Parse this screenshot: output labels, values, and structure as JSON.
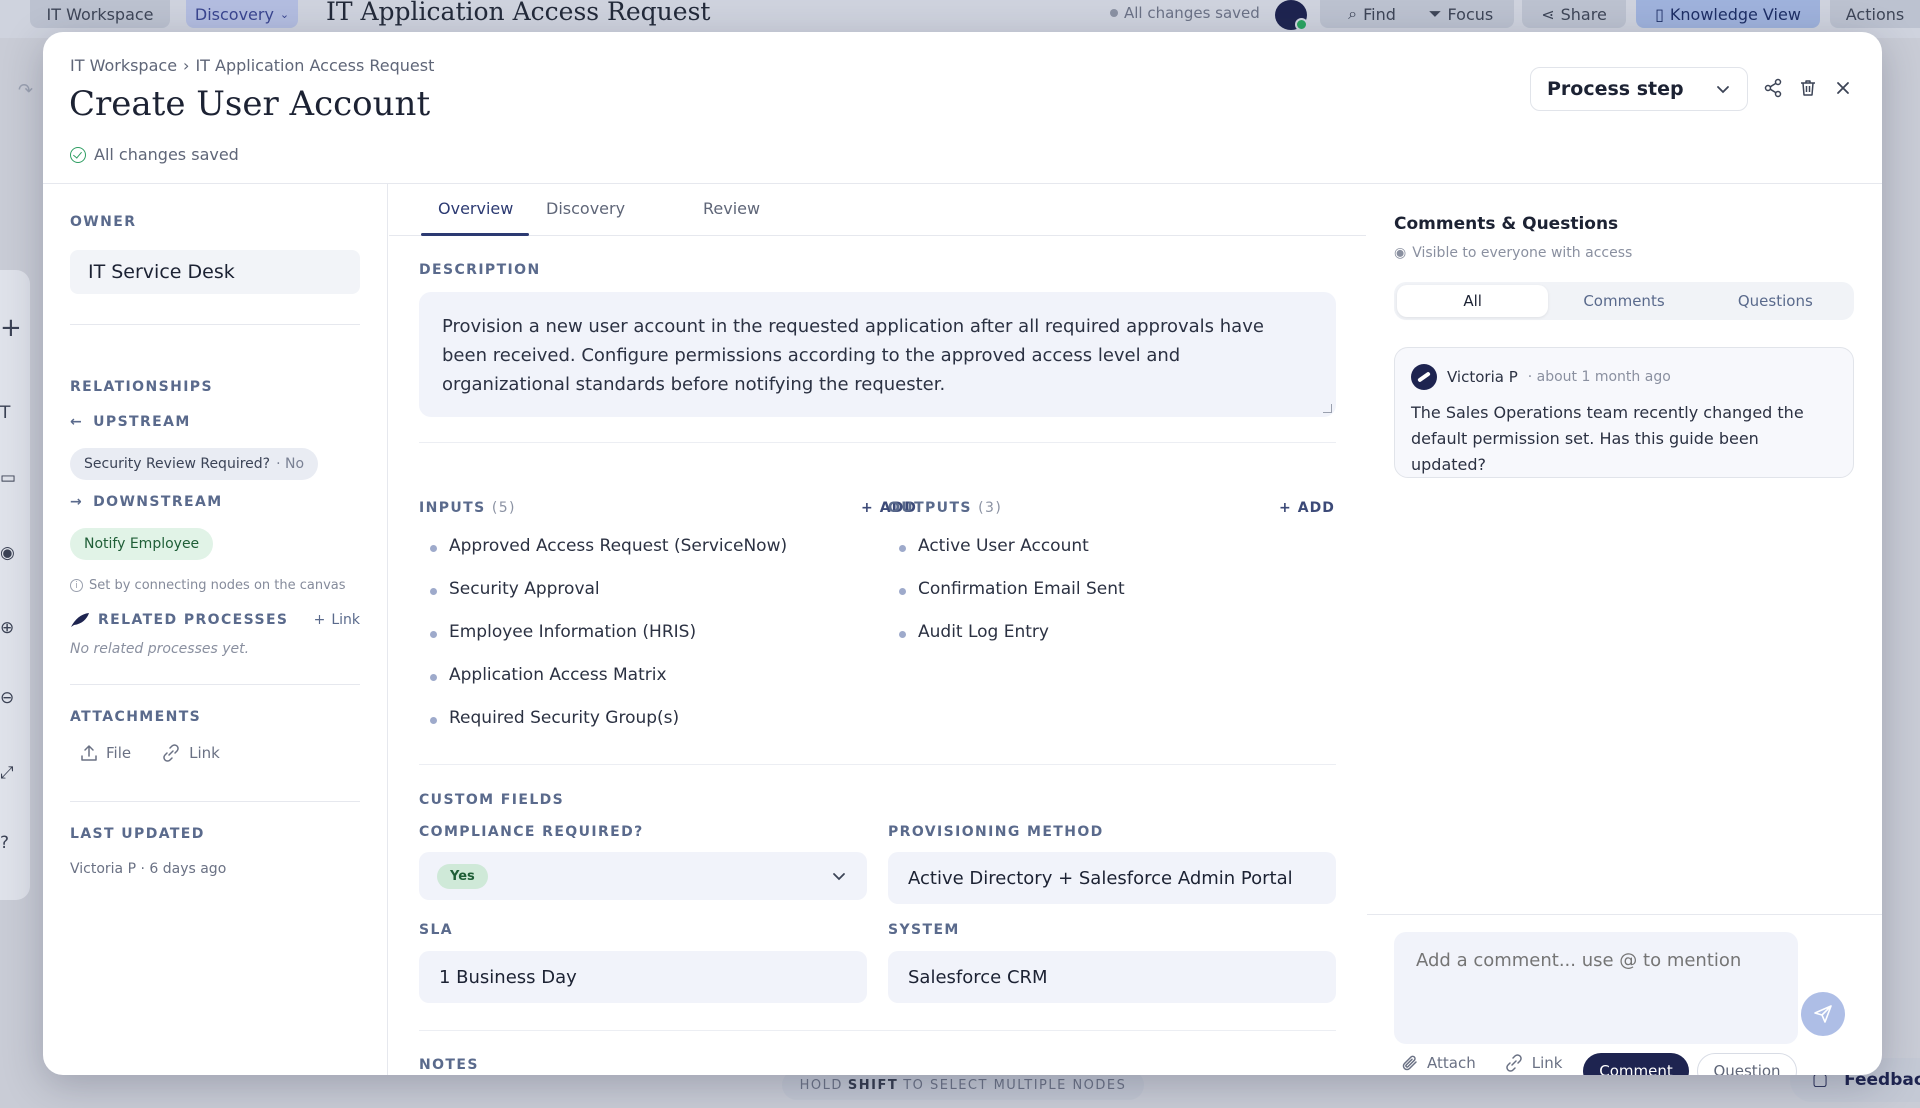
{
  "background": {
    "workspace_pill": "IT Workspace",
    "discovery_pill": "Discovery",
    "title": "IT Application Access Request",
    "saved": "All changes saved",
    "find": "Find",
    "focus": "Focus",
    "share": "Share",
    "knowledge_view": "Knowledge View",
    "actions": "Actions",
    "hint_prefix": "HOLD",
    "hint_key": "SHIFT",
    "hint_suffix": "TO SELECT MULTIPLE NODES",
    "feedback": "Feedback"
  },
  "modal": {
    "breadcrumb": {
      "root": "IT Workspace",
      "sep": "›",
      "current": "IT Application Access Request"
    },
    "title": "Create User Account",
    "saved_status": "All changes saved",
    "type_select": "Process step"
  },
  "left": {
    "owner_label": "OWNER",
    "owner_value": "IT Service Desk",
    "relationships_label": "RELATIONSHIPS",
    "upstream_label": "UPSTREAM",
    "upstream_chip": {
      "label": "Security Review Required?",
      "value": "· No"
    },
    "downstream_label": "DOWNSTREAM",
    "downstream_chip": "Notify Employee",
    "canvas_hint": "Set by connecting nodes on the canvas",
    "related_label": "RELATED PROCESSES",
    "related_link": "Link",
    "related_empty": "No related processes yet.",
    "attachments_label": "ATTACHMENTS",
    "attach_file": "File",
    "attach_link": "Link",
    "last_updated_label": "LAST UPDATED",
    "last_updated_value": "Victoria P · 6 days ago"
  },
  "center": {
    "tabs": [
      "Overview",
      "Discovery",
      "Review"
    ],
    "description_label": "DESCRIPTION",
    "description": "Provision a new user account in the requested application after all required approvals have been received. Configure permissions according to the approved access level and organizational standards before notifying the requester.",
    "inputs_label": "INPUTS",
    "inputs_count": "(5)",
    "inputs": [
      "Approved Access Request (ServiceNow)",
      "Security Approval",
      "Employee Information (HRIS)",
      "Application Access Matrix",
      "Required Security Group(s)"
    ],
    "outputs_label": "OUTPUTS",
    "outputs_count": "(3)",
    "outputs": [
      "Active User Account",
      "Confirmation Email Sent",
      "Audit Log Entry"
    ],
    "add_label": "ADD",
    "custom_fields_label": "CUSTOM FIELDS",
    "compliance_label": "COMPLIANCE REQUIRED?",
    "compliance_value": "Yes",
    "provisioning_label": "PROVISIONING METHOD",
    "provisioning_value": "Active Directory + Salesforce Admin Portal",
    "sla_label": "SLA",
    "sla_value": "1 Business Day",
    "system_label": "SYSTEM",
    "system_value": "Salesforce CRM",
    "notes_label": "NOTES"
  },
  "right": {
    "title": "Comments & Questions",
    "subtitle": "Visible to everyone with access",
    "filters": [
      "All",
      "Comments",
      "Questions"
    ],
    "comment": {
      "author": "Victoria P",
      "time": "· about 1 month ago",
      "body": "The Sales Operations team recently changed the default permission set. Has this guide been updated?"
    },
    "composer_placeholder": "Add a comment... use @ to mention",
    "attach": "Attach",
    "link": "Link",
    "comment_btn": "Comment",
    "question_btn": "Question"
  }
}
